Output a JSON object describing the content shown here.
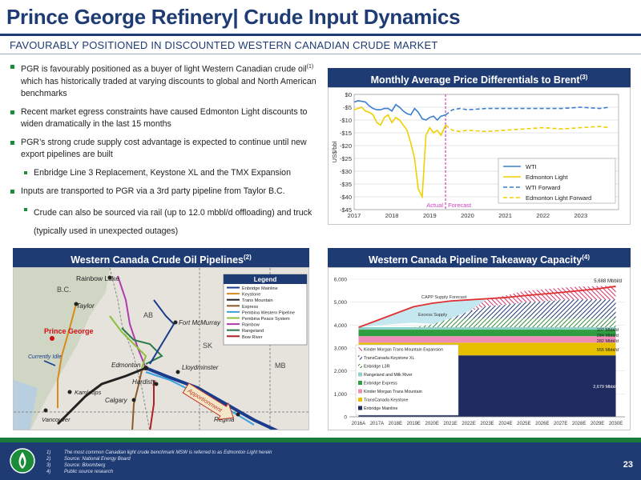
{
  "header": {
    "title": "Prince George Refinery| Crude Input Dynamics",
    "subtitle": "FAVOURABLY POSITIONED IN DISCOUNTED WESTERN CANADIAN CRUDE MARKET"
  },
  "bullets": {
    "b1_pre": "PGR is favourably positioned as a buyer of light Western Canadian crude oil",
    "b1_sup": "(1)",
    "b1_post": " which has historically traded at varying discounts to global and North American benchmarks",
    "b2": "Recent market egress constraints have caused Edmonton Light discounts to widen dramatically in the last 15 months",
    "b3": "PGR’s strong crude supply cost advantage is expected to continue until new export pipelines are built",
    "b3_sub": "Enbridge Line 3 Replacement, Keystone XL and the TMX Expansion",
    "b4": "Inputs are transported to PGR via a 3rd party pipeline from Taylor B.C.",
    "b4_sub": "Crude can also be sourced via rail (up to 12.0 mbbl/d offloading) and truck (typically used in unexpected outages)"
  },
  "panels": {
    "price_title": "Monthly Average Price Differentials to Brent",
    "price_sup": "(3)",
    "map_title": "Western Canada Crude Oil Pipelines",
    "map_sup": "(2)",
    "capacity_title": "Western Canada Pipeline Takeaway Capacity",
    "capacity_sup": "(4)"
  },
  "map": {
    "legend_title": "Legend",
    "legend_items": [
      "Enbridge Mainline",
      "Keystone",
      "Trans Mountain",
      "Express",
      "Pembina Western Pipeline",
      "Pembina Peace System",
      "Rainbow",
      "Rangeland",
      "Bow River"
    ],
    "legend_colors": [
      "#1a3c8c",
      "#d98a1a",
      "#222222",
      "#8a5a2a",
      "#3aa0e0",
      "#8cbf3a",
      "#b03ab0",
      "#2a7a4a",
      "#b02020"
    ],
    "places": {
      "rainbow_lake": "Rainbow Lake",
      "bc": "B.C.",
      "taylor": "Taylor",
      "prince_george": "Prince George",
      "currently_idle": "Currently Idle",
      "kamloops": "Kamloops",
      "vancouver": "Vancouver",
      "ab": "AB",
      "fort_mcmurray": "Fort McMurray",
      "sk": "SK",
      "lloydminster": "Lloydminster",
      "edmonton": "Edmonton",
      "hardisty": "Hardisty",
      "calgary": "Calgary",
      "regina": "Regina",
      "mb": "MB",
      "apportionment": "Apportionment"
    }
  },
  "chart_data": [
    {
      "type": "line",
      "title": "Monthly Average Price Differentials to Brent(3)",
      "ylabel": "US$/bbl",
      "ylim": [
        -45,
        0
      ],
      "yticks": [
        "$0",
        "-$5",
        "-$10",
        "-$15",
        "-$20",
        "-$25",
        "-$30",
        "-$35",
        "-$40",
        "-$45"
      ],
      "xticks": [
        "2017",
        "2018",
        "2019",
        "2020",
        "2021",
        "2022",
        "2023"
      ],
      "divider_labels": {
        "actual": "Actual",
        "forecast": "Forecast"
      },
      "divider_x": 2019.42,
      "series": [
        {
          "name": "WTI",
          "color": "#3a7fd0",
          "dash": "solid",
          "x": [
            2017.0,
            2017.1,
            2017.2,
            2017.3,
            2017.4,
            2017.5,
            2017.6,
            2017.7,
            2017.8,
            2017.9,
            2018.0,
            2018.1,
            2018.2,
            2018.3,
            2018.4,
            2018.5,
            2018.6,
            2018.7,
            2018.8,
            2018.9,
            2019.0,
            2019.1,
            2019.2,
            2019.3,
            2019.42
          ],
          "y": [
            -3,
            -2.5,
            -2.7,
            -3,
            -4.5,
            -5.5,
            -6,
            -6,
            -5.5,
            -5.5,
            -6.5,
            -4,
            -5,
            -6.5,
            -7.5,
            -8,
            -5.5,
            -7,
            -9.5,
            -10,
            -9,
            -8.5,
            -10,
            -8.5,
            -8
          ]
        },
        {
          "name": "Edmonton Light",
          "color": "#f0d000",
          "dash": "solid",
          "x": [
            2017.0,
            2017.1,
            2017.2,
            2017.3,
            2017.4,
            2017.5,
            2017.6,
            2017.7,
            2017.8,
            2017.9,
            2018.0,
            2018.1,
            2018.2,
            2018.3,
            2018.4,
            2018.5,
            2018.6,
            2018.7,
            2018.8,
            2018.9,
            2019.0,
            2019.1,
            2019.2,
            2019.3,
            2019.42
          ],
          "y": [
            -6,
            -5.5,
            -5,
            -6.5,
            -7,
            -8,
            -11,
            -12,
            -9,
            -8,
            -11,
            -9,
            -10,
            -12,
            -14,
            -19,
            -25,
            -37,
            -40,
            -16,
            -13,
            -15,
            -14,
            -16,
            -12
          ]
        },
        {
          "name": "WTI Forward",
          "color": "#3a7fd0",
          "dash": "dashed",
          "x": [
            2019.42,
            2019.6,
            2019.8,
            2020.0,
            2020.5,
            2021.0,
            2021.5,
            2022.0,
            2022.5,
            2023.0,
            2023.5,
            2023.75
          ],
          "y": [
            -8,
            -6,
            -5.5,
            -6,
            -5.5,
            -5.5,
            -5.5,
            -5.5,
            -5.5,
            -5,
            -5.5,
            -5
          ]
        },
        {
          "name": "Edmonton Light Forward",
          "color": "#f0d000",
          "dash": "dashed",
          "x": [
            2019.42,
            2019.6,
            2019.8,
            2020.0,
            2020.5,
            2021.0,
            2021.5,
            2022.0,
            2022.5,
            2023.0,
            2023.5,
            2023.75
          ],
          "y": [
            -12,
            -14,
            -14.5,
            -14,
            -14.5,
            -14,
            -13.5,
            -13,
            -13.5,
            -13,
            -12.5,
            -13
          ]
        }
      ]
    },
    {
      "type": "area",
      "title": "Western Canada Pipeline Takeaway Capacity(4)",
      "ylim": [
        0,
        6000
      ],
      "yticks": [
        "0",
        "1,000",
        "2,000",
        "3,000",
        "4,000",
        "5,000",
        "6,000"
      ],
      "categories": [
        "2016A",
        "2017A",
        "2018E",
        "2019E",
        "2020E",
        "2021E",
        "2022E",
        "2023E",
        "2024E",
        "2025E",
        "2026E",
        "2027E",
        "2028E",
        "2029E",
        "2030E"
      ],
      "stack_series": [
        {
          "name": "Enbridge Mainline",
          "color": "#1f2a5e",
          "value": 2679
        },
        {
          "name": "TransCanada Keystone",
          "color": "#e6c000",
          "value": 555
        },
        {
          "name": "Kinder Morgan Trans Mountain",
          "color": "#f08cb8",
          "value": 282
        },
        {
          "name": "Enbridge Express",
          "color": "#2e9e40",
          "value": 284
        },
        {
          "name": "Rangeland and Milk River",
          "color": "#8fd0c8",
          "value": 107
        }
      ],
      "expansion_series": [
        {
          "name": "Enbridge L3R",
          "color": "#3a8a3a"
        },
        {
          "name": "TransCanada Keystone XL",
          "color": "#1f3b73"
        },
        {
          "name": "Kinder Morgan Trans Mountain Expansion",
          "color": "#d8336a"
        }
      ],
      "legend_order": [
        "Kinder Morgan Trans Mountain Expansion",
        "TransCanada Keystone XL",
        "Enbridge L3R",
        "Rangeland and Milk River",
        "Enbridge Express",
        "Kinder Morgan Trans Mountain",
        "TransCanada Keystone",
        "Enbridge Mainline"
      ],
      "capp_supply_forecast": [
        3900,
        4200,
        4500,
        4800,
        4950,
        5050,
        5100,
        5150,
        5200,
        5280,
        5350,
        5420,
        5500,
        5580,
        5688
      ],
      "excess_capacity_row": [
        3900,
        3980,
        4050,
        4100,
        4050,
        4000,
        4000,
        4000,
        4000,
        4000,
        4000,
        4000,
        4000,
        4000,
        4000
      ],
      "annotations": {
        "capp_label": "CAPP Supply Forecast",
        "excess_label": "Excess Supply",
        "total_label": "5,688 Mbbl/d",
        "rangeland_label": "107 Mbbl/d",
        "express_label": "284 Mbbl/d",
        "tm_label": "282 Mbbl/d",
        "keystone_label": "555 Mbbl/d",
        "mainline_label": "2,679 Mbbl/d"
      }
    }
  ],
  "footer": {
    "notes": [
      {
        "n": "1)",
        "text": "The most common Canadian light crude benchmark MSW is referred to as Edmonton Light herein"
      },
      {
        "n": "2)",
        "text": "Source: National Energy Board"
      },
      {
        "n": "3)",
        "text": "Source: Bloomberg"
      },
      {
        "n": "4)",
        "text": "Public source research"
      }
    ],
    "page_number": "23"
  }
}
